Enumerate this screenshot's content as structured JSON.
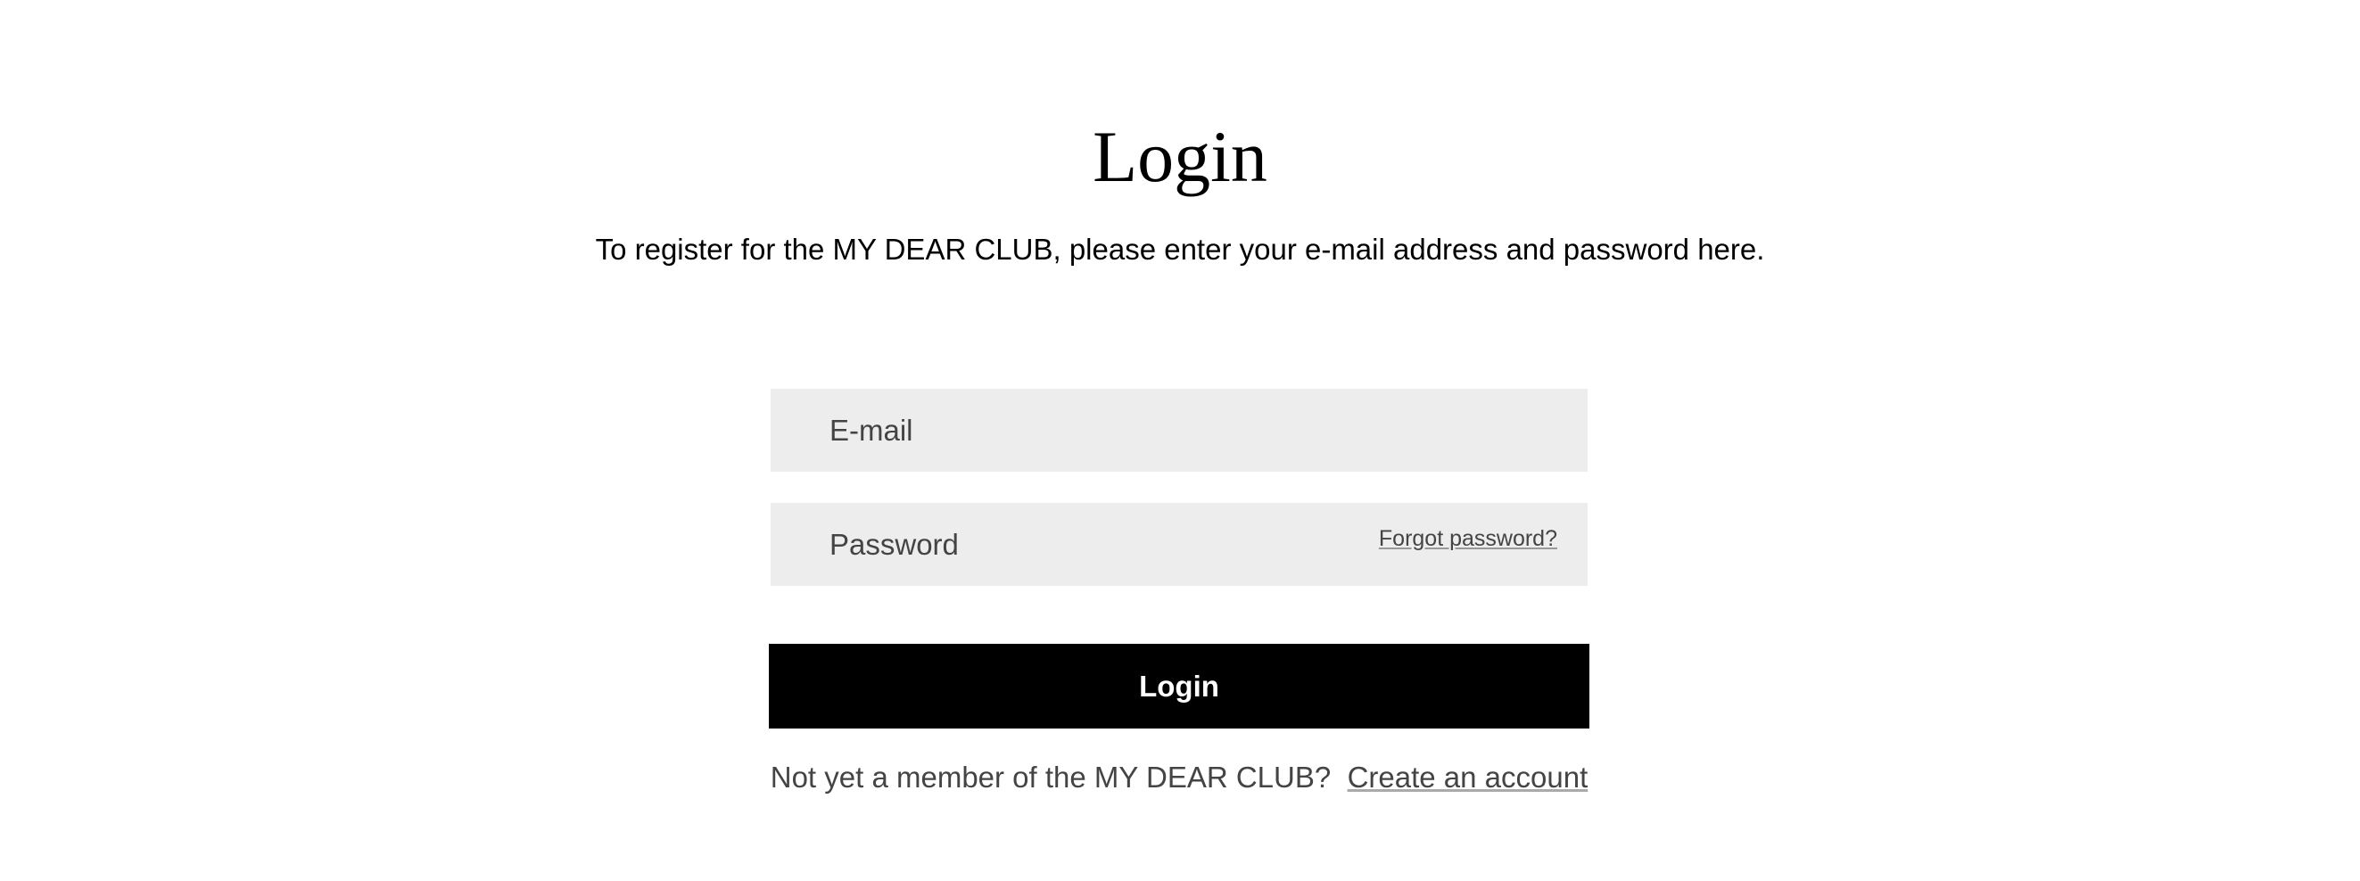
{
  "title": "Login",
  "subtitle": "To register for the MY DEAR CLUB, please enter your e-mail address and password here.",
  "form": {
    "email_placeholder": "E-mail",
    "email_value": "",
    "password_placeholder": "Password",
    "password_value": "",
    "forgot_label": "Forgot password?",
    "login_label": "Login"
  },
  "footer": {
    "text": "Not yet a member of the MY DEAR CLUB? ",
    "link": "Create an account"
  }
}
